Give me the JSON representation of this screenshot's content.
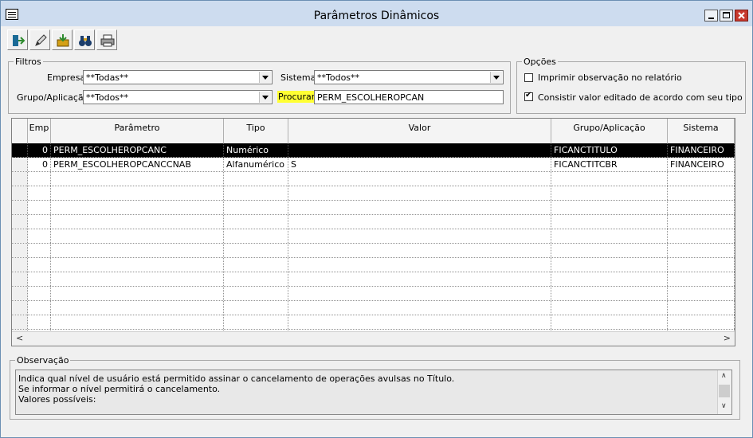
{
  "window": {
    "title": "Parâmetros Dinâmicos"
  },
  "toolbar": {
    "buttons": [
      "exit-icon",
      "edit-icon",
      "save-icon",
      "binoculars-icon",
      "print-icon"
    ]
  },
  "filtros": {
    "legend": "Filtros",
    "empresa_label": "Empresa",
    "empresa_value": "**Todas**",
    "sistema_label": "Sistema",
    "sistema_value": "**Todos**",
    "grupo_label": "Grupo/Aplicação",
    "grupo_value": "**Todos**",
    "procurar_label": "Procurar",
    "procurar_value": "PERM_ESCOLHEROPCAN"
  },
  "opcoes": {
    "legend": "Opções",
    "opt1_label": "Imprimir observação no relatório",
    "opt1_checked": false,
    "opt2_label": "Consistir valor editado de acordo com seu tipo",
    "opt2_checked": true
  },
  "grid": {
    "columns": [
      "Emp",
      "Parâmetro",
      "Tipo",
      "Valor",
      "Grupo/Aplicação",
      "Sistema"
    ],
    "rows": [
      {
        "emp": "0",
        "parametro": "PERM_ESCOLHEROPCANC",
        "tipo": "Numérico",
        "valor": "",
        "grupo": "FICANCTITULO",
        "sistema": "FINANCEIRO"
      },
      {
        "emp": "0",
        "parametro": "PERM_ESCOLHEROPCANCCNAB",
        "tipo": "Alfanumérico",
        "valor": "S",
        "grupo": "FICANCTITCBR",
        "sistema": "FINANCEIRO"
      }
    ]
  },
  "observacao": {
    "legend": "Observação",
    "lines": [
      "Indica qual nível de usuário está permitido assinar o cancelamento de operações avulsas no Título.",
      "Se informar o nível permitirá o cancelamento.",
      "Valores possíveis:"
    ]
  },
  "colors": {
    "titlebar": "#cddcef",
    "selected_row": "#000000",
    "search_highlight": "#ffff33"
  }
}
